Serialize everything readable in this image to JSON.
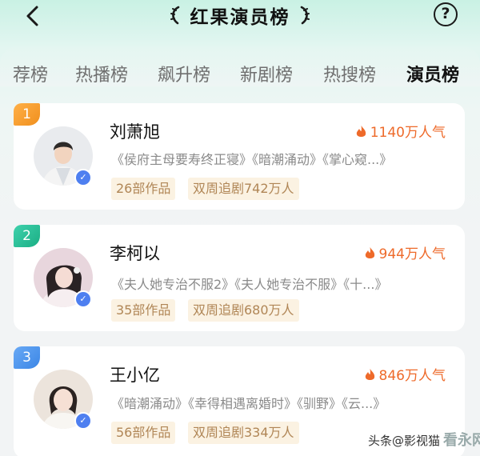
{
  "header": {
    "title": "红果演员榜",
    "back_icon": "chevron-left-icon",
    "help_label": "?"
  },
  "tabs": [
    {
      "label": "荐榜",
      "active": false
    },
    {
      "label": "热播榜",
      "active": false
    },
    {
      "label": "飙升榜",
      "active": false
    },
    {
      "label": "新剧榜",
      "active": false
    },
    {
      "label": "热搜榜",
      "active": false
    },
    {
      "label": "演员榜",
      "active": true
    }
  ],
  "actors": [
    {
      "rank": "1",
      "name": "刘萧旭",
      "popularity": "1140万人气",
      "works": "《侯府主母要寿终正寝》《暗潮涌动》《掌心窥...》",
      "works_count": "26部作品",
      "followers": "双周追剧742万人"
    },
    {
      "rank": "2",
      "name": "李柯以",
      "popularity": "944万人气",
      "works": "《夫人她专治不服2》《夫人她专治不服》《十...》",
      "works_count": "35部作品",
      "followers": "双周追剧680万人"
    },
    {
      "rank": "3",
      "name": "王小亿",
      "popularity": "846万人气",
      "works": "《暗潮涌动》《幸得相遇离婚时》《驯野》《云...》",
      "works_count": "56部作品",
      "followers": "双周追剧334万人"
    }
  ],
  "watermark": {
    "text": "头条@影视猫",
    "logo": "看永网"
  },
  "colors": {
    "accent_orange": "#ee6a2a",
    "rank1": "#f5a030",
    "rank2": "#22b98f",
    "rank3": "#4a92ec",
    "verified": "#4e7ff0",
    "tag_bg": "#fbf2e2"
  }
}
